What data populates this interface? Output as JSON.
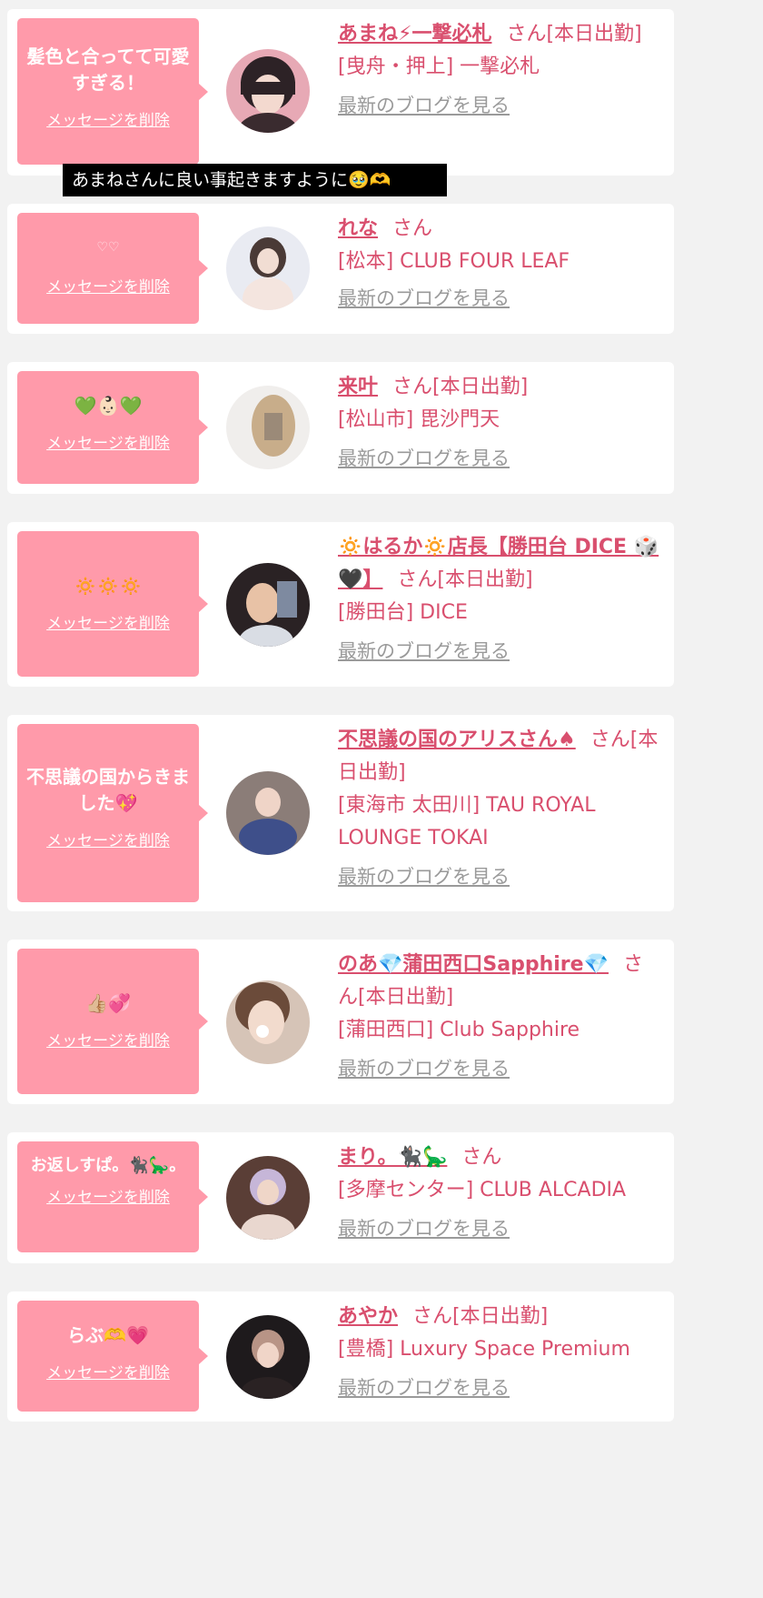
{
  "tooltip": "あまねさんに良い事起きますように🥹🫶",
  "delete_label": "メッセージを削除",
  "blog_label": "最新のブログを見る",
  "san_suffix": "さん",
  "entries": [
    {
      "message": "髪色と合ってて可愛すぎる！",
      "name": "あまね⚡一撃必札",
      "status": "[本日出勤]",
      "shop": "[曳舟・押上] 一撃必札"
    },
    {
      "message": "♡♡",
      "name": "れな",
      "status": "",
      "shop": "[松本] CLUB FOUR LEAF"
    },
    {
      "message": "💚👶🏻💚",
      "name": "来叶",
      "status": "[本日出勤]",
      "shop": "[松山市] 毘沙門天"
    },
    {
      "message": "🔅🔅🔅",
      "name": "🔅はるか🔅店長【勝田台 DICE 🎲🖤】",
      "status": "[本日出勤]",
      "shop": "[勝田台] DICE"
    },
    {
      "message": "不思議の国からきました💖",
      "name": "不思議の国のアリスさん♠",
      "status": "[本日出勤]",
      "shop": "[東海市 太田川] TAU ROYAL LOUNGE TOKAI"
    },
    {
      "message": "👍🏼💞",
      "name": "のあ💎蒲田西口Sapphire💎",
      "status": "[本日出勤]",
      "shop": "[蒲田西口] Club Sapphire"
    },
    {
      "message": "お返しすぱ。🐈‍⬛🦕。",
      "name": "まり。🐈‍⬛🦕",
      "status": "",
      "shop": "[多摩センター] CLUB ALCADIA"
    },
    {
      "message": "らぶ🫶💗",
      "name": "あやか",
      "status": "[本日出勤]",
      "shop": "[豊橋] Luxury Space Premium"
    }
  ]
}
